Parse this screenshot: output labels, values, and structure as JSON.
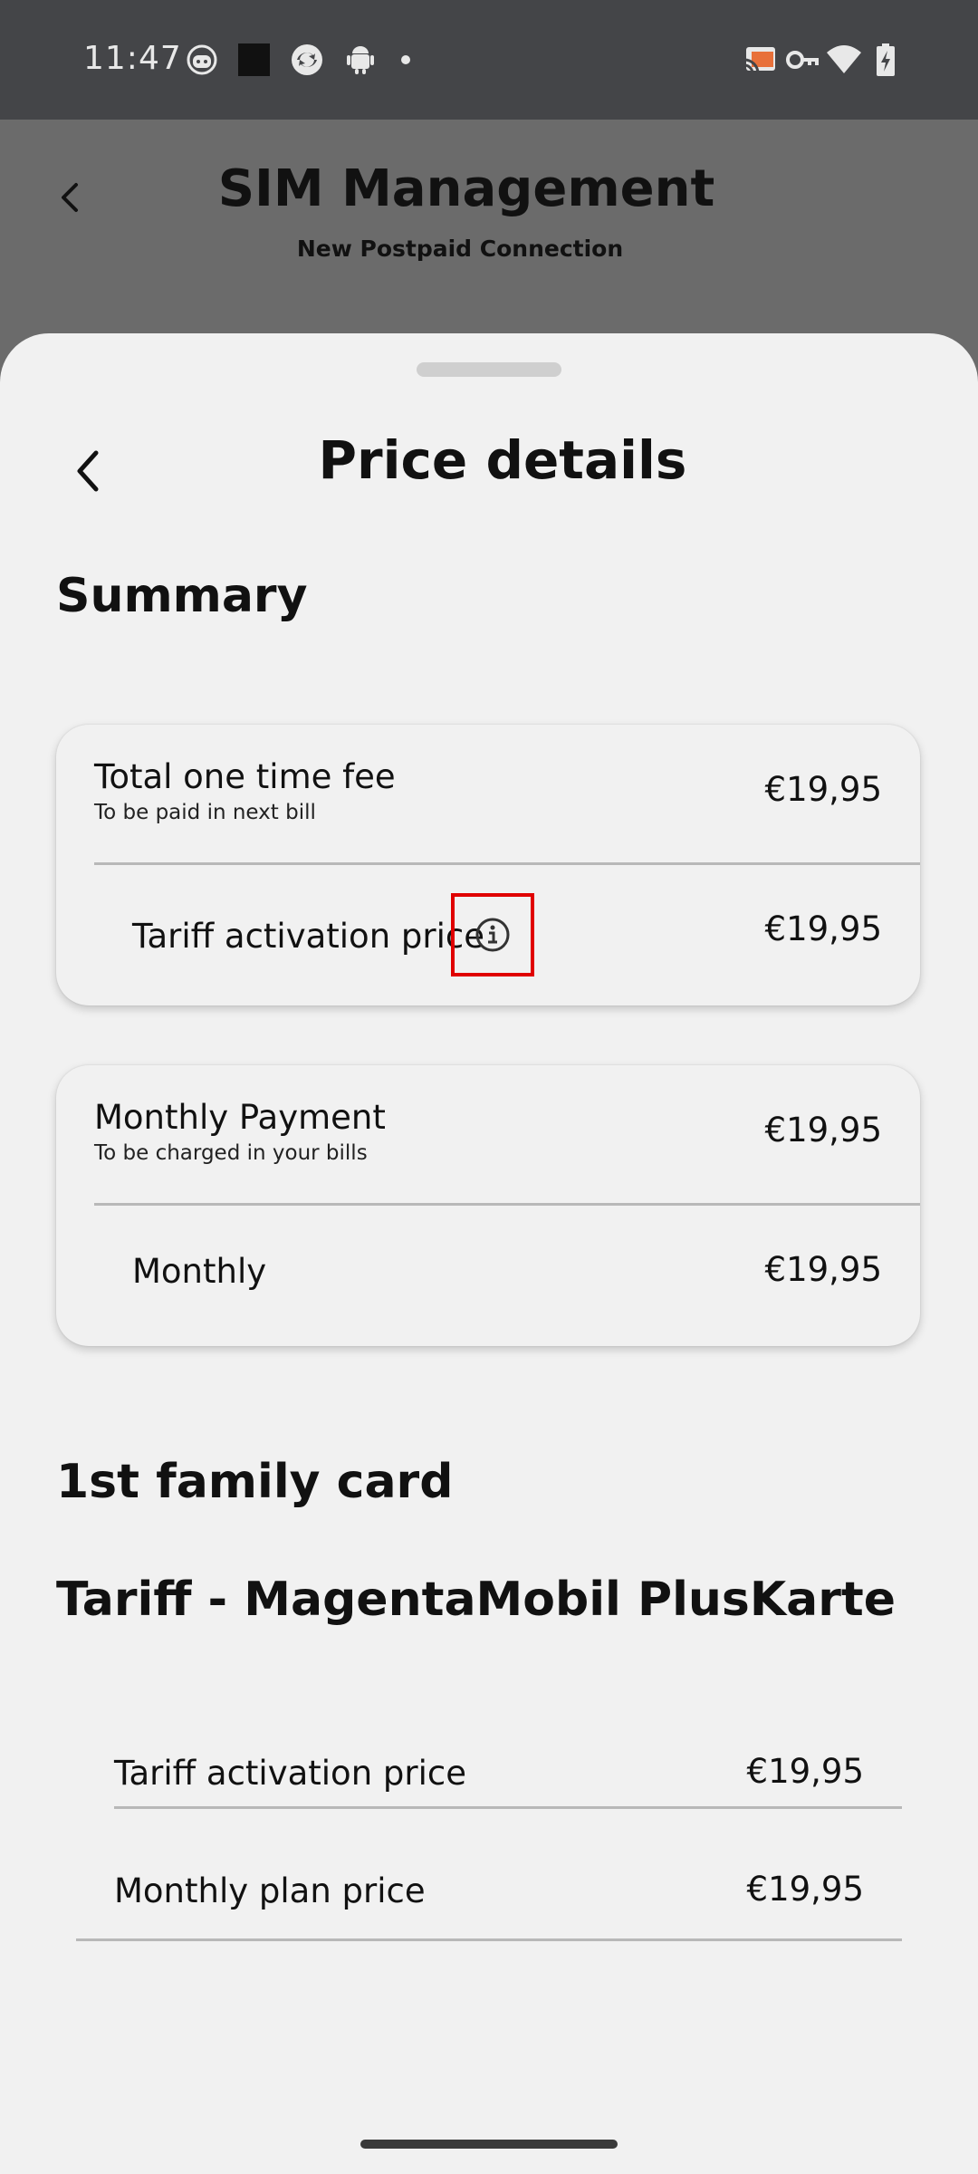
{
  "status_bar": {
    "time": "11:47",
    "left_icons": [
      "face-notification-icon",
      "square-notification-icon",
      "sync-icon",
      "android-icon",
      "dot-icon"
    ],
    "right_icons": [
      "cast-icon",
      "vpn-key-icon",
      "wifi-icon",
      "battery-charging-icon"
    ]
  },
  "backdrop": {
    "title": "SIM Management",
    "subtitle": "New Postpaid Connection"
  },
  "sheet": {
    "title": "Price details",
    "summary_heading": "Summary",
    "one_time_card": {
      "title": "Total one time fee",
      "subtitle": "To be paid in next bill",
      "total": "€19,95",
      "row_label": "Tariff activation price",
      "row_price": "€19,95"
    },
    "monthly_card": {
      "title": "Monthly Payment",
      "subtitle": "To be charged in your bills",
      "total": "€19,95",
      "row_label": "Monthly",
      "row_price": "€19,95"
    },
    "family_heading": "1st family card",
    "tariff_heading": "Tariff - MagentaMobil PlusKarte",
    "tariff_rows": [
      {
        "label": "Tariff activation price",
        "price": "€19,95"
      },
      {
        "label": "Monthly plan price",
        "price": "€19,95"
      }
    ]
  },
  "colors": {
    "highlight_box": "#e00000",
    "sheet_background": "#f1f1f1",
    "scrim": "#6b6b6b",
    "status_bar": "#444548"
  }
}
